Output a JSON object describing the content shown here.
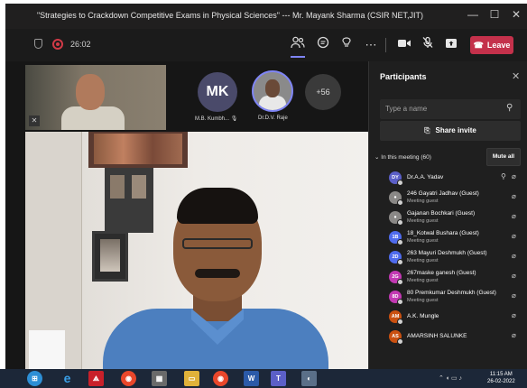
{
  "window": {
    "title": "\"Strategies to Crackdown Competitive Exams in Physical Sciences\" --- Mr. Mayank Sharma (CSIR NET,JIT)",
    "minimize": "—",
    "maximize": "☐",
    "close": "✕"
  },
  "toolbar": {
    "timer": "26:02",
    "leave_label": "Leave",
    "icons": [
      "shield-icon",
      "record-icon",
      "participants-icon",
      "chat-icon",
      "reactions-icon",
      "more-icon",
      "camera-icon",
      "mic-off-icon",
      "share-icon",
      "leave-phone-icon"
    ]
  },
  "stage": {
    "avatar_initials": "MK",
    "avatar1_name": "M.B. Kumbh...",
    "avatar2_name": "Dr.D.V. Raje",
    "more_count": "+56"
  },
  "panel": {
    "title": "Participants",
    "search_placeholder": "Type a name",
    "share_label": "Share invite",
    "section_label": "In this meeting (60)",
    "mute_all_label": "Mute all",
    "participants": [
      {
        "initials": "DY",
        "name": "Dr.A.A. Yadav",
        "sub": "",
        "color": "#5b5fc7"
      },
      {
        "initials": "",
        "name": "246 Gayatri Jadhav (Guest)",
        "sub": "Meeting guest",
        "color": "#8a8886"
      },
      {
        "initials": "",
        "name": "Gajanan Bochkari (Guest)",
        "sub": "Meeting guest",
        "color": "#8a8886"
      },
      {
        "initials": "1B",
        "name": "18_Kotwal Bushara (Guest)",
        "sub": "Meeting guest",
        "color": "#4f6bed"
      },
      {
        "initials": "2D",
        "name": "263 Mayuri Deshmukh (Guest)",
        "sub": "Meeting guest",
        "color": "#4f6bed"
      },
      {
        "initials": "2G",
        "name": "267maske ganesh (Guest)",
        "sub": "Meeting guest",
        "color": "#c239b3"
      },
      {
        "initials": "8D",
        "name": "80 Premkumar Deshmukh (Guest)",
        "sub": "Meeting guest",
        "color": "#c239b3"
      },
      {
        "initials": "AM",
        "name": "A.K. Mungle",
        "sub": "",
        "color": "#ca5010"
      },
      {
        "initials": "AS",
        "name": "AMARSINH SALUNKE",
        "sub": "",
        "color": "#ca5010"
      }
    ]
  },
  "taskbar": {
    "time": "11:15 AM",
    "date": "26-02-2022"
  }
}
